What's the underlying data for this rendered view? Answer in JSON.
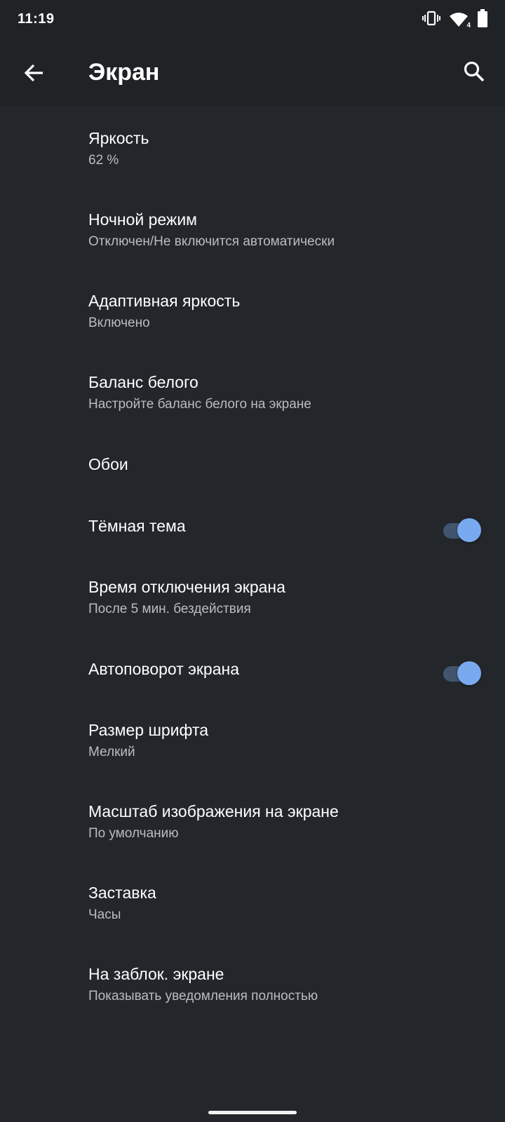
{
  "status_bar": {
    "time": "11:19",
    "icons": [
      "vibrate-icon",
      "wifi-icon",
      "battery-icon"
    ],
    "wifi_badge": "4"
  },
  "app_bar": {
    "title": "Экран",
    "back_icon": "arrow-back-icon",
    "search_icon": "search-icon"
  },
  "settings": {
    "brightness": {
      "label": "Яркость",
      "value": "62 %"
    },
    "night_mode": {
      "label": "Ночной режим",
      "value": "Отключен/Не включится автоматически"
    },
    "adaptive_brightness": {
      "label": "Адаптивная яркость",
      "value": "Включено"
    },
    "white_balance": {
      "label": "Баланс белого",
      "value": "Настройте баланс белого на экране"
    },
    "wallpaper": {
      "label": "Обои"
    },
    "dark_theme": {
      "label": "Тёмная тема",
      "enabled": true
    },
    "screen_timeout": {
      "label": "Время отключения экрана",
      "value": "После 5 мин. бездействия"
    },
    "auto_rotate": {
      "label": "Автоповорот экрана",
      "enabled": true
    },
    "font_size": {
      "label": "Размер шрифта",
      "value": "Мелкий"
    },
    "display_size": {
      "label": "Масштаб изображения на экране",
      "value": "По умолчанию"
    },
    "screensaver": {
      "label": "Заставка",
      "value": "Часы"
    },
    "lock_screen": {
      "label": "На заблок. экране",
      "value": "Показывать уведомления полностью"
    }
  },
  "colors": {
    "background": "#23272b",
    "app_bar": "#202326",
    "accent": "#79aaf0",
    "switch_track": "#41556f",
    "secondary_text": "#b9bdc1"
  }
}
